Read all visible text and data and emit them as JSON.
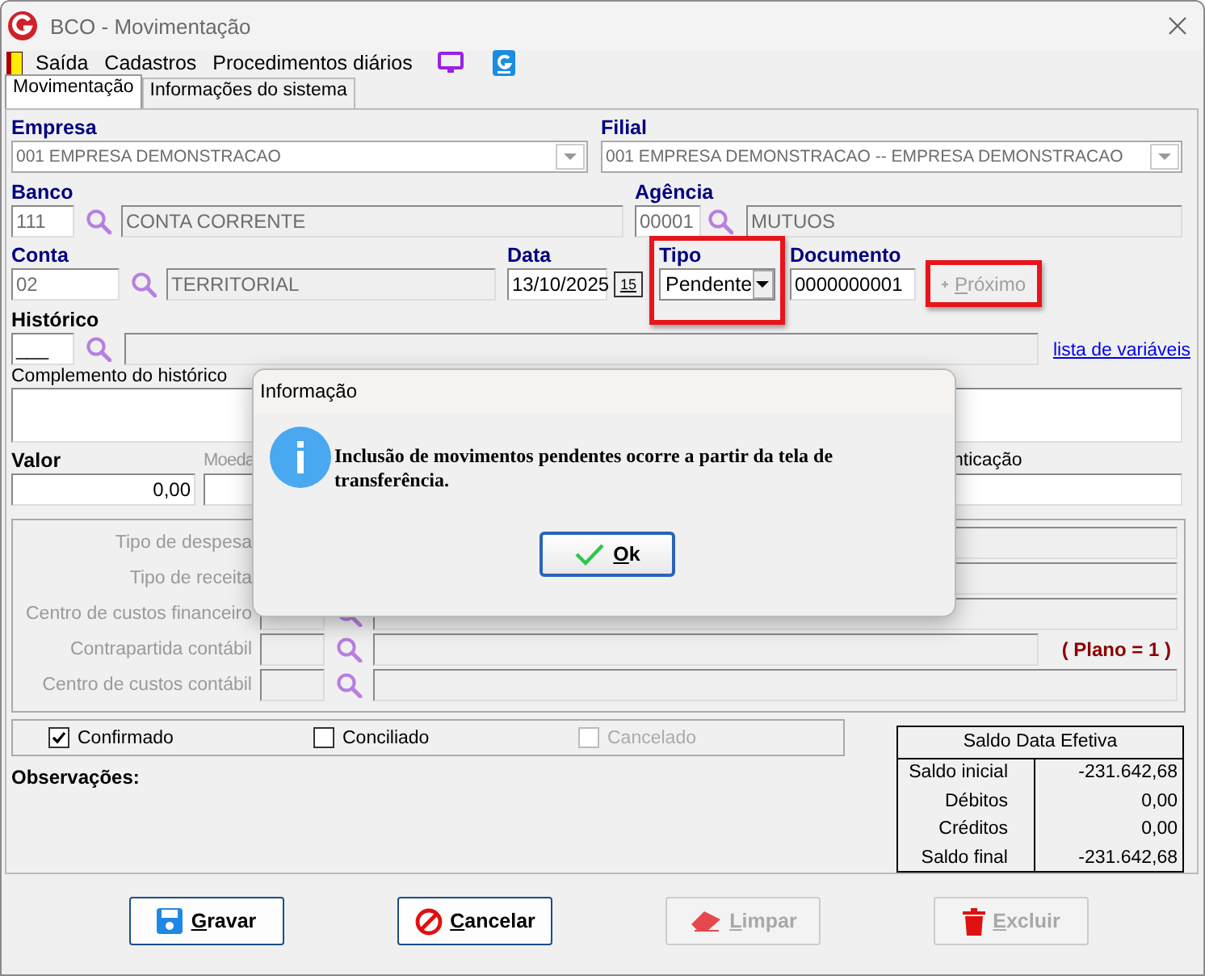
{
  "window": {
    "title": "BCO - Movimentação"
  },
  "menu": [
    {
      "label": "Saída"
    },
    {
      "label": "Cadastros"
    },
    {
      "label": "Procedimentos diários"
    }
  ],
  "tabs": [
    {
      "label": "Movimentação",
      "selected": true
    },
    {
      "label": "Informações do sistema",
      "selected": false
    }
  ],
  "empresa": {
    "label": "Empresa",
    "value": "001 EMPRESA DEMONSTRACAO"
  },
  "filial": {
    "label": "Filial",
    "value": "001 EMPRESA DEMONSTRACAO -- EMPRESA DEMONSTRACAO"
  },
  "banco": {
    "label": "Banco",
    "code": "111",
    "name": "CONTA CORRENTE"
  },
  "agencia": {
    "label": "Agência",
    "code": "00001",
    "name": "MUTUOS"
  },
  "conta": {
    "label": "Conta",
    "code": "02",
    "name": "TERRITORIAL"
  },
  "data": {
    "label": "Data",
    "value": "13/10/2025",
    "calendar_day": "15"
  },
  "tipo": {
    "label": "Tipo",
    "value": "Pendente",
    "highlighted": true
  },
  "documento": {
    "label": "Documento",
    "value": "0000000001"
  },
  "proximo_button": {
    "label": "Próximo",
    "disabled": true,
    "highlighted": true
  },
  "historico": {
    "label": "Histórico",
    "code": "___",
    "link": "lista de variáveis"
  },
  "complemento": {
    "label": "Complemento do histórico"
  },
  "valor": {
    "label": "Valor",
    "value": "0,00"
  },
  "moeda": {
    "label": "Moeda"
  },
  "autenticacao": {
    "label": "nticação"
  },
  "classificacao_rows": [
    {
      "label": "Tipo de despesa"
    },
    {
      "label": "Tipo de receita"
    },
    {
      "label": "Centro de custos financeiro"
    },
    {
      "label": "Contrapartida contábil",
      "note": "( Plano = 1 )"
    },
    {
      "label": "Centro de custos contábil"
    }
  ],
  "status_checks": [
    {
      "label": "Confirmado",
      "checked": true,
      "disabled": false
    },
    {
      "label": "Conciliado",
      "checked": false,
      "disabled": false
    },
    {
      "label": "Cancelado",
      "checked": false,
      "disabled": true
    }
  ],
  "observacoes": {
    "label": "Observações:"
  },
  "saldo": {
    "title": "Saldo Data Efetiva",
    "rows": [
      {
        "label": "Saldo inicial",
        "value": "-231.642,68"
      },
      {
        "label": "Débitos",
        "value": "0,00"
      },
      {
        "label": "Créditos",
        "value": "0,00"
      },
      {
        "label": "Saldo final",
        "value": "-231.642,68"
      }
    ]
  },
  "buttons": [
    {
      "label": "Gravar",
      "kind": "save",
      "disabled": false
    },
    {
      "label": "Cancelar",
      "kind": "cancel",
      "disabled": false
    },
    {
      "label": "Limpar",
      "kind": "clear",
      "disabled": true
    },
    {
      "label": "Excluir",
      "kind": "delete",
      "disabled": true
    }
  ],
  "dialog": {
    "title": "Informação",
    "message": "Inclusão de movimentos pendentes ocorre a partir da tela de transferência.",
    "button": "Ok"
  }
}
